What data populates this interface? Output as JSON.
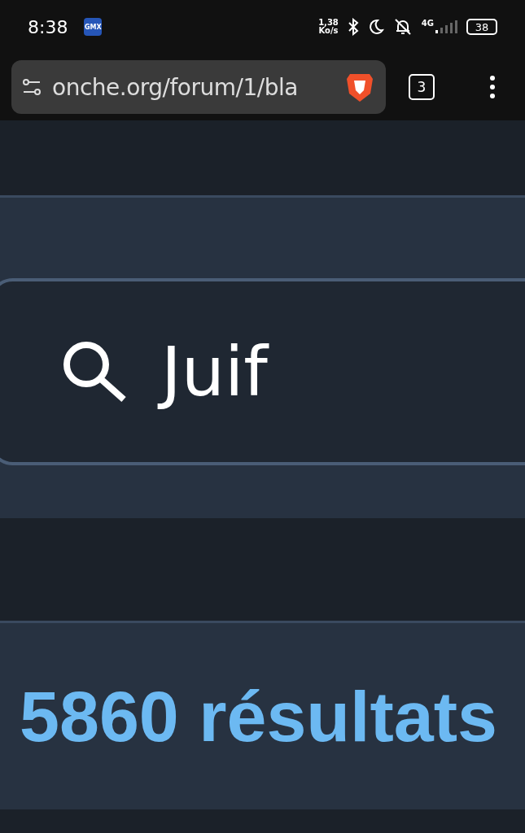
{
  "status_bar": {
    "time": "8:38",
    "app_badge": "GMX",
    "speed_value": "1,38",
    "speed_unit": "Ko/s",
    "network": "4G",
    "battery": "38"
  },
  "browser": {
    "url": "onche.org/forum/1/bla",
    "tab_count": "3"
  },
  "search": {
    "value": "Juif"
  },
  "results": {
    "count": "5860 résultats"
  }
}
